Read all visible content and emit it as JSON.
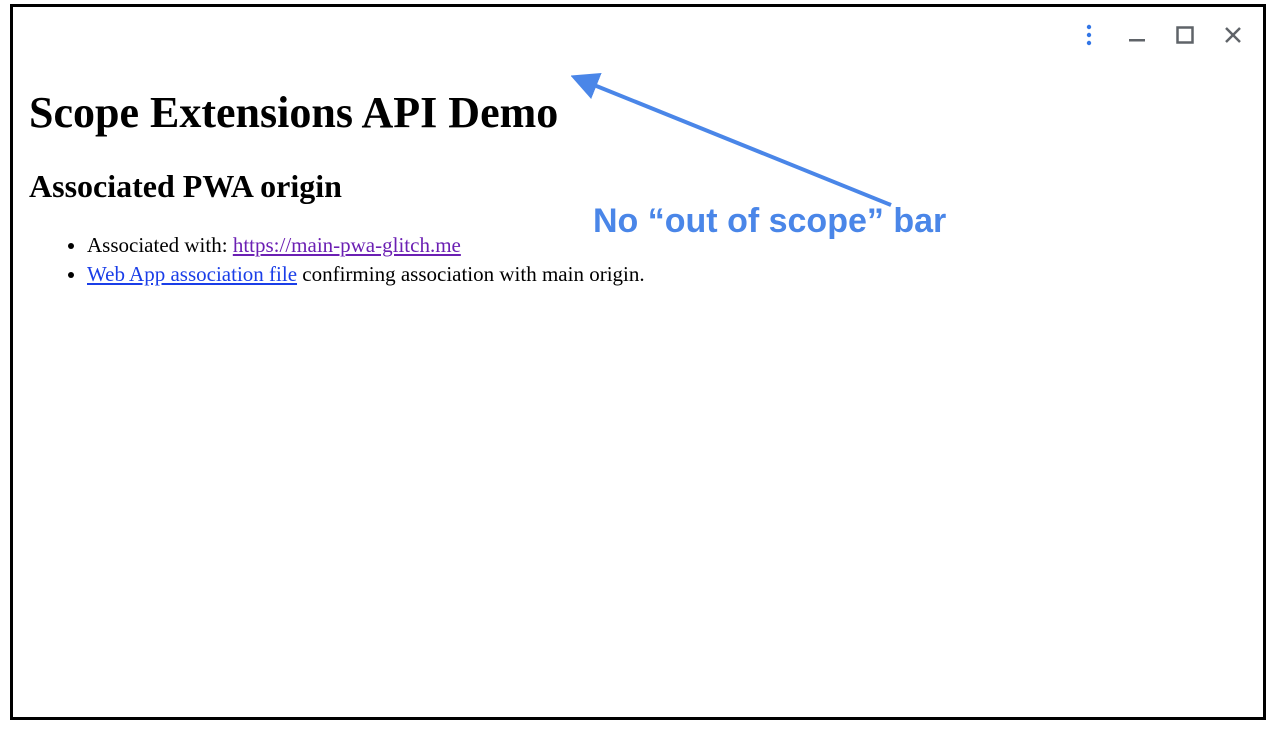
{
  "page": {
    "heading": "Scope Extensions API Demo",
    "subheading": "Associated PWA origin"
  },
  "list": {
    "item0_prefix": "Associated with: ",
    "item0_link": "https://main-pwa-glitch.me",
    "item1_link": "Web App association file",
    "item1_suffix": " confirming association with main origin."
  },
  "annotation": {
    "text": "No “out of scope” bar"
  },
  "icons": {
    "menu": "more-vert",
    "minimize": "minimize",
    "maximize": "maximize",
    "close": "close"
  },
  "colors": {
    "annotation": "#4a86e8",
    "link_visited": "#6b1fb3",
    "link": "#1a3ee8",
    "window_control": "#5f6368"
  }
}
